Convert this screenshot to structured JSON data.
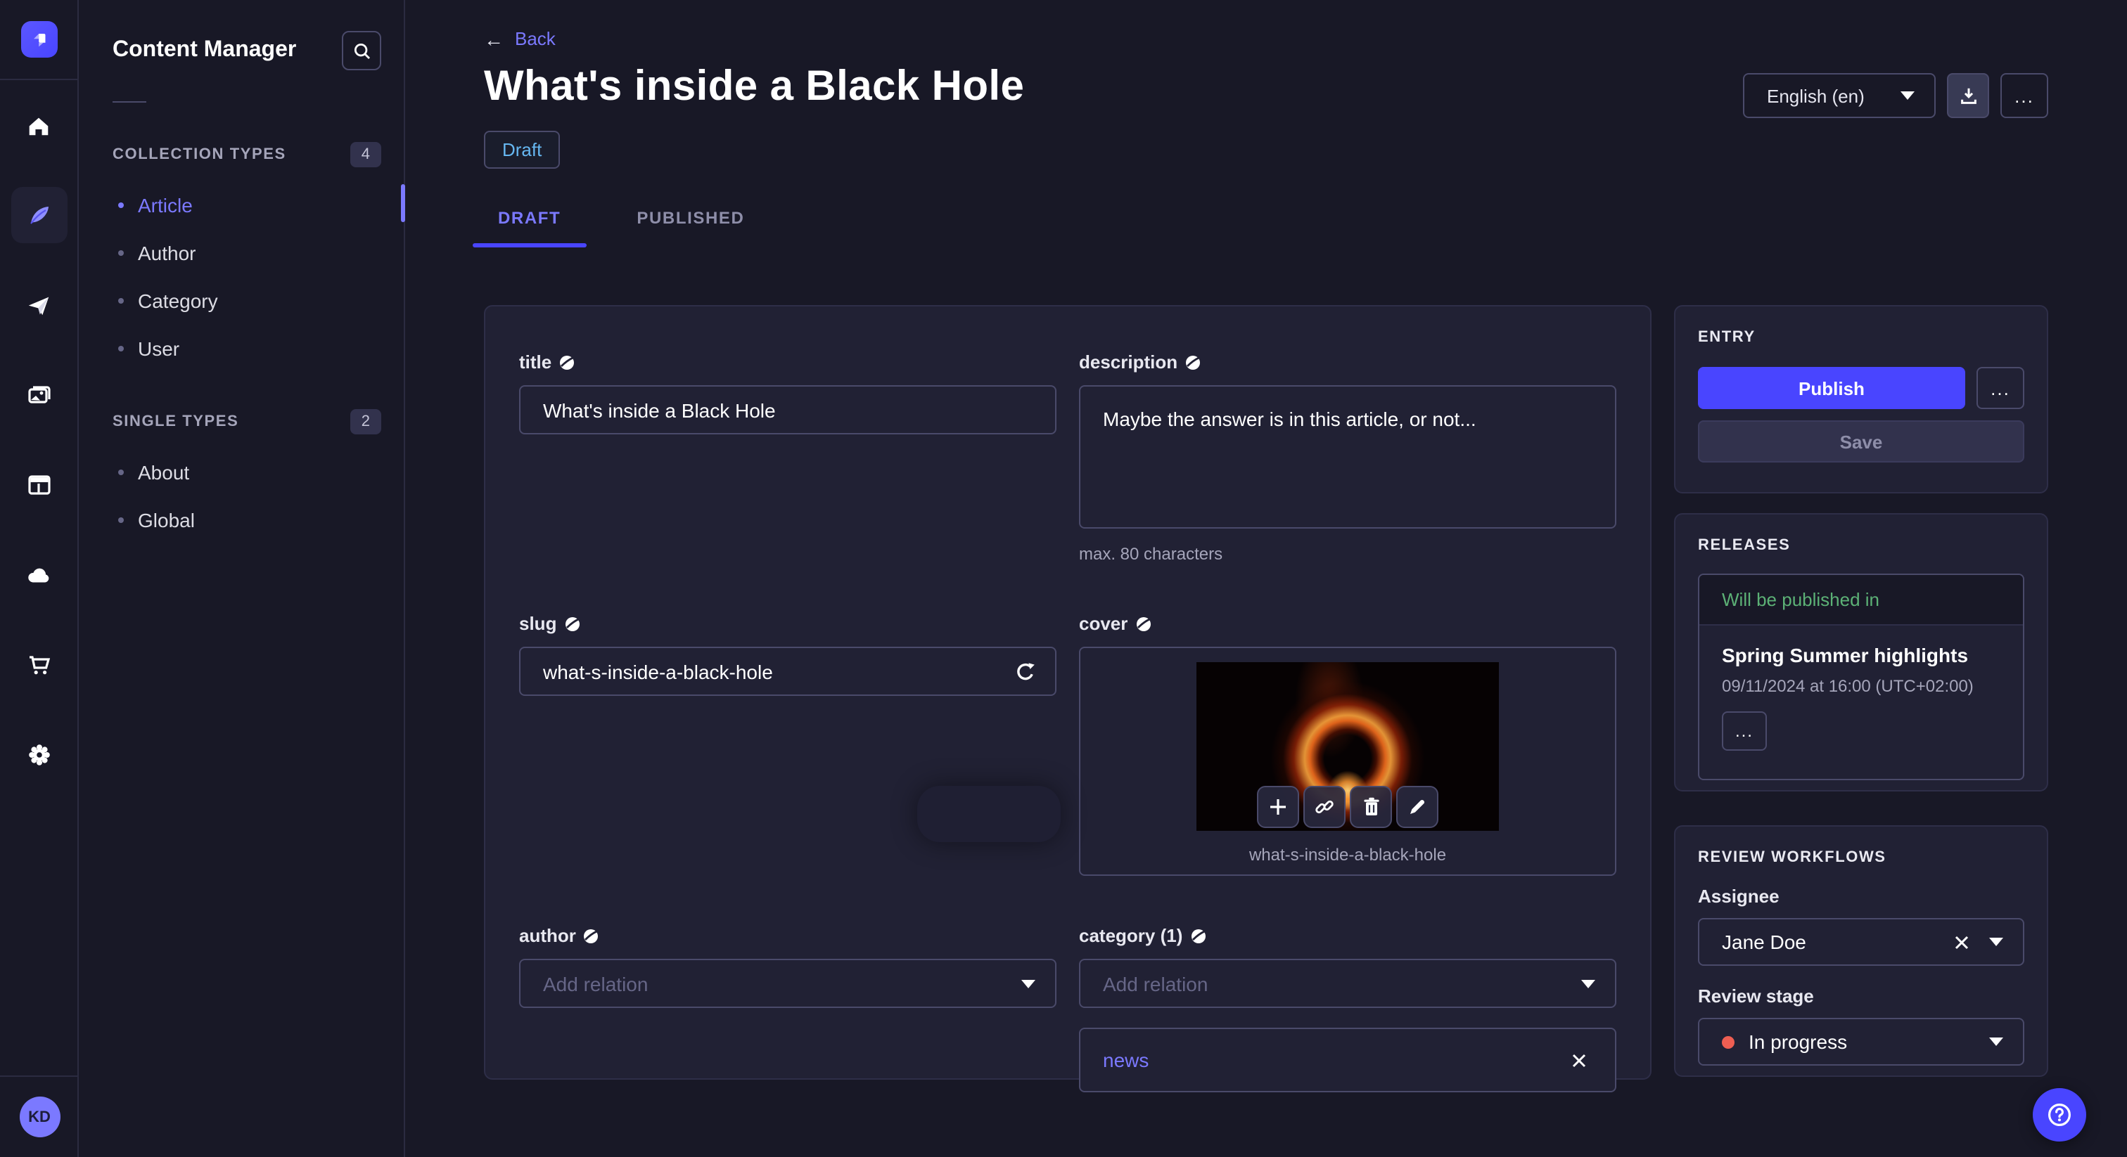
{
  "app": {
    "avatar_initials": "KD"
  },
  "colors": {
    "accent": "#4945ff",
    "accent_light": "#7b79ff",
    "draft_blue": "#66b7f1",
    "success_green": "#5cb176",
    "danger_red": "#ee5e52",
    "background": "#181826",
    "surface": "#212134"
  },
  "rail_icons": [
    "strapi-logo",
    "home",
    "feather",
    "paper-plane",
    "media-gallery",
    "layout",
    "cloud",
    "shopping-cart",
    "gear"
  ],
  "sidebar": {
    "title": "Content Manager",
    "sections": [
      {
        "label": "COLLECTION TYPES",
        "count": "4",
        "items": [
          {
            "label": "Article"
          },
          {
            "label": "Author"
          },
          {
            "label": "Category"
          },
          {
            "label": "User"
          }
        ]
      },
      {
        "label": "SINGLE TYPES",
        "count": "2",
        "items": [
          {
            "label": "About"
          },
          {
            "label": "Global"
          }
        ]
      }
    ]
  },
  "header": {
    "back_label": "Back",
    "title": "What's inside a Black Hole",
    "status_badge": "Draft",
    "tabs": [
      {
        "label": "DRAFT"
      },
      {
        "label": "PUBLISHED"
      }
    ],
    "locale": "English (en)",
    "more_label": "..."
  },
  "form": {
    "title": {
      "label": "title",
      "value": "What's inside a Black Hole"
    },
    "description": {
      "label": "description",
      "value": "Maybe the answer is in this article, or not...",
      "hint": "max. 80 characters"
    },
    "slug": {
      "label": "slug",
      "value": "what-s-inside-a-black-hole"
    },
    "cover": {
      "label": "cover",
      "filename": "what-s-inside-a-black-hole"
    },
    "author": {
      "label": "author",
      "placeholder": "Add relation"
    },
    "category": {
      "label": "category (1)",
      "placeholder": "Add relation",
      "relations": [
        {
          "label": "news"
        }
      ]
    }
  },
  "entry_panel": {
    "title": "ENTRY",
    "publish_label": "Publish",
    "save_label": "Save",
    "more_label": "..."
  },
  "releases_panel": {
    "title": "RELEASES",
    "status": "Will be published in",
    "release_name": "Spring Summer highlights",
    "release_date": "09/11/2024 at 16:00 (UTC+02:00)",
    "more_label": "..."
  },
  "review_panel": {
    "title": "REVIEW WORKFLOWS",
    "assignee_label": "Assignee",
    "assignee_value": "Jane Doe",
    "stage_label": "Review stage",
    "stage_value": "In progress"
  }
}
